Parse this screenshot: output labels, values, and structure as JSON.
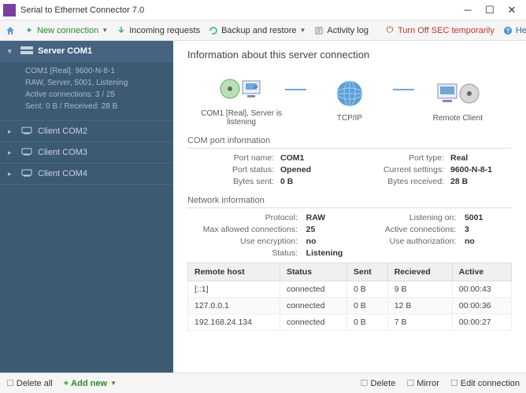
{
  "title": "Serial to Ethernet Connector 7.0",
  "toolbar": {
    "home": "",
    "new_connection": "New connection",
    "incoming": "Incoming requests",
    "backup": "Backup and restore",
    "activity": "Activity log",
    "turn_off": "Turn Off SEC temporarily",
    "help": "Help"
  },
  "sidebar": {
    "server": {
      "label": "Server COM1",
      "details": {
        "line1": "COM1 [Real]: 9600-N-8-1",
        "line2": "RAW, Server, 5001, Listening",
        "line3": "Active connections: 3 / 25",
        "line4": "Sent: 0 B / Received: 28 B"
      }
    },
    "clients": [
      {
        "label": "Client COM2"
      },
      {
        "label": "Client COM3"
      },
      {
        "label": "Client COM4"
      }
    ]
  },
  "content": {
    "heading": "Information about this server connection",
    "diagram": {
      "node1": "COM1 [Real], Server is listening",
      "node2": "TCP/IP",
      "node3": "Remote Client"
    },
    "com_section": "COM port information",
    "com": {
      "port_name_l": "Port name:",
      "port_name_v": "COM1",
      "port_type_l": "Port type:",
      "port_type_v": "Real",
      "port_status_l": "Port status:",
      "port_status_v": "Opened",
      "cur_set_l": "Current settings:",
      "cur_set_v": "9600-N-8-1",
      "bytes_sent_l": "Bytes sent:",
      "bytes_sent_v": "0 B",
      "bytes_recv_l": "Bytes received:",
      "bytes_recv_v": "28 B"
    },
    "net_section": "Network information",
    "net": {
      "proto_l": "Protocol:",
      "proto_v": "RAW",
      "listen_l": "Listening on:",
      "listen_v": "5001",
      "maxc_l": "Max allowed connections:",
      "maxc_v": "25",
      "active_l": "Active connections:",
      "active_v": "3",
      "enc_l": "Use encryption:",
      "enc_v": "no",
      "auth_l": "Use authorization:",
      "auth_v": "no",
      "status_l": "Status:",
      "status_v": "Listening"
    },
    "table": {
      "h1": "Remote host",
      "h2": "Status",
      "h3": "Sent",
      "h4": "Recieved",
      "h5": "Active",
      "rows": [
        {
          "host": "[::1]",
          "status": "connected",
          "sent": "0 B",
          "recv": "9 B",
          "active": "00:00:43"
        },
        {
          "host": "127.0.0.1",
          "status": "connected",
          "sent": "0 B",
          "recv": "12 B",
          "active": "00:00:36"
        },
        {
          "host": "192.168.24.134",
          "status": "connected",
          "sent": "0 B",
          "recv": "7 B",
          "active": "00:00:27"
        }
      ]
    }
  },
  "bottom": {
    "delete_all": "Delete all",
    "add_new": "Add new",
    "delete": "Delete",
    "mirror": "Mirror",
    "edit": "Edit connection"
  }
}
